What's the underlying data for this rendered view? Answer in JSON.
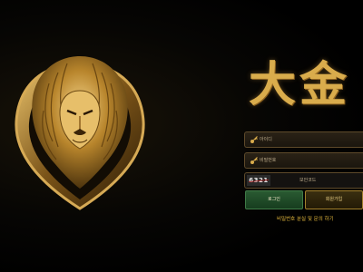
{
  "logo": {
    "text": "大金"
  },
  "form": {
    "id_placeholder": "아이디",
    "password_placeholder": "비밀번호",
    "captcha_code": "6321",
    "captcha_placeholder": "보안코드"
  },
  "buttons": {
    "login": "로그인",
    "join": "회원가입"
  },
  "footer_link": "비밀번호 분실 및 문의 하기",
  "colors": {
    "gold": "#d9ac4c",
    "login_green": "#1f4a28",
    "join_gold": "#a2802c",
    "link_yellow": "#e2b73c"
  },
  "icons": {
    "id": "key-icon",
    "password": "key-icon",
    "emblem": "lion-emblem"
  }
}
